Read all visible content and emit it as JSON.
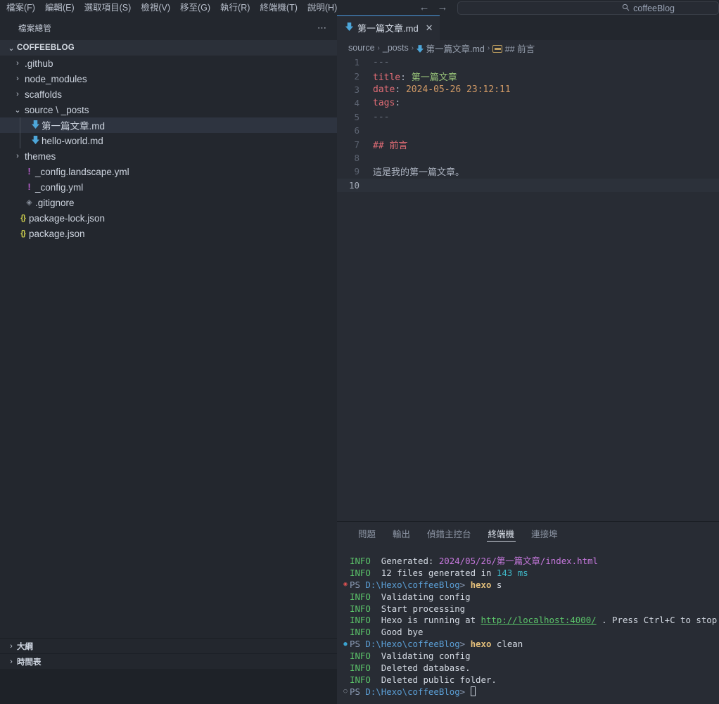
{
  "titlebar": {
    "menus": [
      "檔案(F)",
      "編輯(E)",
      "選取項目(S)",
      "檢視(V)",
      "移至(G)",
      "執行(R)",
      "終端機(T)",
      "說明(H)"
    ],
    "nav_back": "←",
    "nav_forward": "→",
    "search_icon": "search-icon",
    "search_value": "coffeeBlog"
  },
  "sidebar": {
    "title": "檔案總管",
    "actions_label": "⋯",
    "root": {
      "label": "COFFEEBLOG",
      "twisty": "⌄"
    },
    "items": [
      {
        "label": ".github",
        "twisty": "›",
        "icon": "folder",
        "depth": 1,
        "selected": false
      },
      {
        "label": "node_modules",
        "twisty": "›",
        "icon": "folder",
        "depth": 1,
        "selected": false
      },
      {
        "label": "scaffolds",
        "twisty": "›",
        "icon": "folder",
        "depth": 1,
        "selected": false
      },
      {
        "label": "source \\ _posts",
        "twisty": "⌄",
        "icon": "folder",
        "depth": 1,
        "selected": false
      },
      {
        "label": "第一篇文章.md",
        "twisty": "",
        "icon": "markdown",
        "depth": 2,
        "selected": true
      },
      {
        "label": "hello-world.md",
        "twisty": "",
        "icon": "markdown",
        "depth": 2,
        "selected": false
      },
      {
        "label": "themes",
        "twisty": "›",
        "icon": "folder",
        "depth": 1,
        "selected": false
      },
      {
        "label": "_config.landscape.yml",
        "twisty": "",
        "icon": "yml",
        "depth": 1,
        "selected": false
      },
      {
        "label": "_config.yml",
        "twisty": "",
        "icon": "yml",
        "depth": 1,
        "selected": false
      },
      {
        "label": ".gitignore",
        "twisty": "",
        "icon": "diamond",
        "depth": 1,
        "selected": false
      },
      {
        "label": "package-lock.json",
        "twisty": "",
        "icon": "json",
        "depth": 0,
        "selected": false
      },
      {
        "label": "package.json",
        "twisty": "",
        "icon": "json",
        "depth": 0,
        "selected": false
      }
    ],
    "bottom_panels": [
      {
        "label": "大綱",
        "twisty": "›"
      },
      {
        "label": "時間表",
        "twisty": "›"
      }
    ]
  },
  "editor": {
    "tab": {
      "label": "第一篇文章.md",
      "close": "✕",
      "icon": "markdown-icon"
    },
    "breadcrumb": [
      {
        "text": "source",
        "icon": ""
      },
      {
        "text": "_posts",
        "icon": ""
      },
      {
        "text": "第一篇文章.md",
        "icon": "markdown-icon"
      },
      {
        "text": "## 前言",
        "icon": "abc-icon"
      }
    ],
    "breadcrumb_sep": "›",
    "current_line": 10,
    "lines": [
      {
        "n": 1,
        "tokens": [
          {
            "t": "---",
            "c": "tk-dash"
          }
        ]
      },
      {
        "n": 2,
        "tokens": [
          {
            "t": "title",
            "c": "tk-key"
          },
          {
            "t": ": ",
            "c": "tk-plain"
          },
          {
            "t": "第一篇文章",
            "c": "tk-str"
          }
        ]
      },
      {
        "n": 3,
        "tokens": [
          {
            "t": "date",
            "c": "tk-key"
          },
          {
            "t": ": ",
            "c": "tk-plain"
          },
          {
            "t": "2024-05-26 23:12:11",
            "c": "tk-num"
          }
        ]
      },
      {
        "n": 4,
        "tokens": [
          {
            "t": "tags",
            "c": "tk-key"
          },
          {
            "t": ":",
            "c": "tk-plain"
          }
        ]
      },
      {
        "n": 5,
        "tokens": [
          {
            "t": "---",
            "c": "tk-dash"
          }
        ]
      },
      {
        "n": 6,
        "tokens": []
      },
      {
        "n": 7,
        "tokens": [
          {
            "t": "## 前言",
            "c": "tk-head"
          }
        ]
      },
      {
        "n": 8,
        "tokens": []
      },
      {
        "n": 9,
        "tokens": [
          {
            "t": "這是我的第一篇文章。",
            "c": "tk-plain"
          }
        ]
      },
      {
        "n": 10,
        "tokens": []
      }
    ]
  },
  "panel": {
    "tabs": [
      {
        "label": "問題",
        "active": false
      },
      {
        "label": "輸出",
        "active": false
      },
      {
        "label": "偵錯主控台",
        "active": false
      },
      {
        "label": "終端機",
        "active": true
      },
      {
        "label": "連接埠",
        "active": false
      }
    ],
    "terminal_lines": [
      {
        "mark": "",
        "segs": [
          {
            "t": "INFO ",
            "c": "t-info"
          },
          {
            "t": " Generated: ",
            "c": "t-white"
          },
          {
            "t": "2024/05/26/第一篇文章/index.html",
            "c": "t-path"
          }
        ]
      },
      {
        "mark": "",
        "segs": [
          {
            "t": "INFO ",
            "c": "t-info"
          },
          {
            "t": " 12 files generated in ",
            "c": "t-white"
          },
          {
            "t": "143 ms",
            "c": "t-cyan"
          }
        ]
      },
      {
        "mark": "err",
        "segs": [
          {
            "t": "PS ",
            "c": "t-ps"
          },
          {
            "t": "D:\\Hexo\\coffeeBlog",
            "c": "t-drive"
          },
          {
            "t": "> ",
            "c": "t-ps"
          },
          {
            "t": "hexo",
            "c": "t-cmd"
          },
          {
            "t": " s",
            "c": "t-white"
          }
        ]
      },
      {
        "mark": "",
        "segs": [
          {
            "t": "INFO ",
            "c": "t-info"
          },
          {
            "t": " Validating config",
            "c": "t-white"
          }
        ]
      },
      {
        "mark": "",
        "segs": [
          {
            "t": "INFO ",
            "c": "t-info"
          },
          {
            "t": " Start processing",
            "c": "t-white"
          }
        ]
      },
      {
        "mark": "",
        "segs": [
          {
            "t": "INFO ",
            "c": "t-info"
          },
          {
            "t": " Hexo is running at ",
            "c": "t-white"
          },
          {
            "t": "http://localhost:4000/",
            "c": "t-link"
          },
          {
            "t": " . Press Ctrl+C to stop.",
            "c": "t-white"
          }
        ]
      },
      {
        "mark": "",
        "segs": [
          {
            "t": "INFO ",
            "c": "t-info"
          },
          {
            "t": " Good bye",
            "c": "t-white"
          }
        ]
      },
      {
        "mark": "ok",
        "segs": [
          {
            "t": "PS ",
            "c": "t-ps"
          },
          {
            "t": "D:\\Hexo\\coffeeBlog",
            "c": "t-drive"
          },
          {
            "t": "> ",
            "c": "t-ps"
          },
          {
            "t": "hexo",
            "c": "t-cmd"
          },
          {
            "t": " clean",
            "c": "t-white"
          }
        ]
      },
      {
        "mark": "",
        "segs": [
          {
            "t": "INFO ",
            "c": "t-info"
          },
          {
            "t": " Validating config",
            "c": "t-white"
          }
        ]
      },
      {
        "mark": "",
        "segs": [
          {
            "t": "INFO ",
            "c": "t-info"
          },
          {
            "t": " Deleted database.",
            "c": "t-white"
          }
        ]
      },
      {
        "mark": "",
        "segs": [
          {
            "t": "INFO ",
            "c": "t-info"
          },
          {
            "t": " Deleted public folder.",
            "c": "t-white"
          }
        ]
      },
      {
        "mark": "idle",
        "segs": [
          {
            "t": "PS ",
            "c": "t-ps"
          },
          {
            "t": "D:\\Hexo\\coffeeBlog",
            "c": "t-drive"
          },
          {
            "t": "> ",
            "c": "t-ps"
          }
        ],
        "cursor": true
      }
    ]
  },
  "colors": {
    "accent_blue": "#4d9ee6",
    "sidebar_bg": "#23272e",
    "editor_bg": "#282c34",
    "markdown_icon": "#4da6d9",
    "yml_icon": "#b45ec9",
    "json_icon": "#cfd04e"
  }
}
